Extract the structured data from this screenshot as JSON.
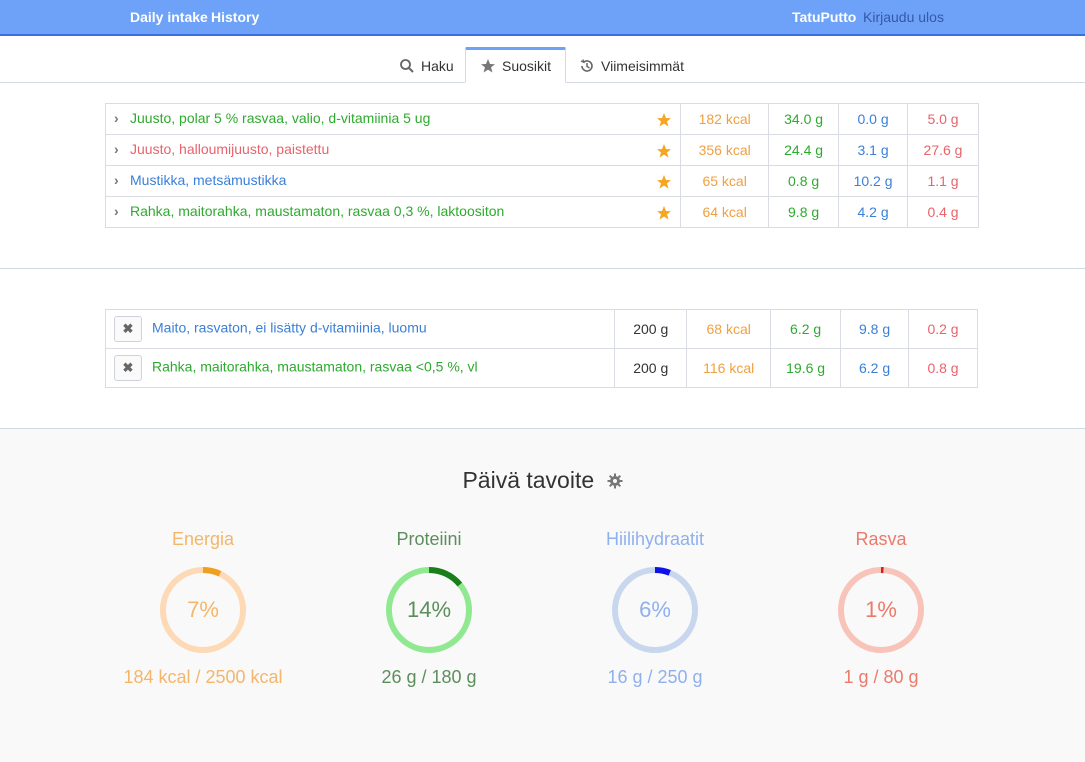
{
  "nav": {
    "daily_intake": "Daily intake",
    "history": "History",
    "username": "TatuPutto",
    "logout": "Kirjaudu ulos"
  },
  "tabs": [
    {
      "label": "Haku",
      "icon": "search-icon"
    },
    {
      "label": "Suosikit",
      "icon": "star-icon"
    },
    {
      "label": "Viimeisimmät",
      "icon": "history-icon"
    }
  ],
  "favorites": [
    {
      "name": "Juusto, polar 5 % rasvaa, valio, d-vitamiinia 5 ug",
      "color": "#2eaa2e",
      "kcal": "182 kcal",
      "protein": "34.0 g",
      "carbs": "0.0 g",
      "fat": "5.0 g"
    },
    {
      "name": "Juusto, halloumijuusto, paistettu",
      "color": "#e8636a",
      "kcal": "356 kcal",
      "protein": "24.4 g",
      "carbs": "3.1 g",
      "fat": "27.6 g"
    },
    {
      "name": "Mustikka, metsämustikka",
      "color": "#3a7fd8",
      "kcal": "65 kcal",
      "protein": "0.8 g",
      "carbs": "10.2 g",
      "fat": "1.1 g"
    },
    {
      "name": "Rahka, maitorahka, maustamaton, rasvaa 0,3 %, laktoositon",
      "color": "#2eaa2e",
      "kcal": "64 kcal",
      "protein": "9.8 g",
      "carbs": "4.2 g",
      "fat": "0.4 g"
    }
  ],
  "intake": [
    {
      "name": "Maito, rasvaton, ei lisätty d-vitamiinia, luomu",
      "color": "#3a7fd8",
      "amount": "200 g",
      "kcal": "68 kcal",
      "protein": "6.2 g",
      "carbs": "9.8 g",
      "fat": "0.2 g"
    },
    {
      "name": "Rahka, maitorahka, maustamaton, rasvaa <0,5 %, vl",
      "color": "#2eaa2e",
      "amount": "200 g",
      "kcal": "116 kcal",
      "protein": "19.6 g",
      "carbs": "6.2 g",
      "fat": "0.8 g"
    }
  ],
  "goals": {
    "title": "Päivä tavoite",
    "items": [
      {
        "name": "Energia",
        "percent_label": "7%",
        "percent": 7,
        "value": "184 kcal / 2500 kcal",
        "text_color": "#f3b66a",
        "track_color": "#fdd9b5",
        "fill_color": "#f0a020"
      },
      {
        "name": "Proteiini",
        "percent_label": "14%",
        "percent": 14,
        "value": "26 g / 180 g",
        "text_color": "#5c8e5c",
        "track_color": "#90e890",
        "fill_color": "#1a7f1a"
      },
      {
        "name": "Hiilihydraatit",
        "percent_label": "6%",
        "percent": 6,
        "value": "16 g / 250 g",
        "text_color": "#8fb0ee",
        "track_color": "#c8d6ee",
        "fill_color": "#1010e8"
      },
      {
        "name": "Rasva",
        "percent_label": "1%",
        "percent": 1,
        "value": "1 g / 80 g",
        "text_color": "#ec7a6a",
        "track_color": "#f8c3b8",
        "fill_color": "#cc2020"
      }
    ]
  }
}
